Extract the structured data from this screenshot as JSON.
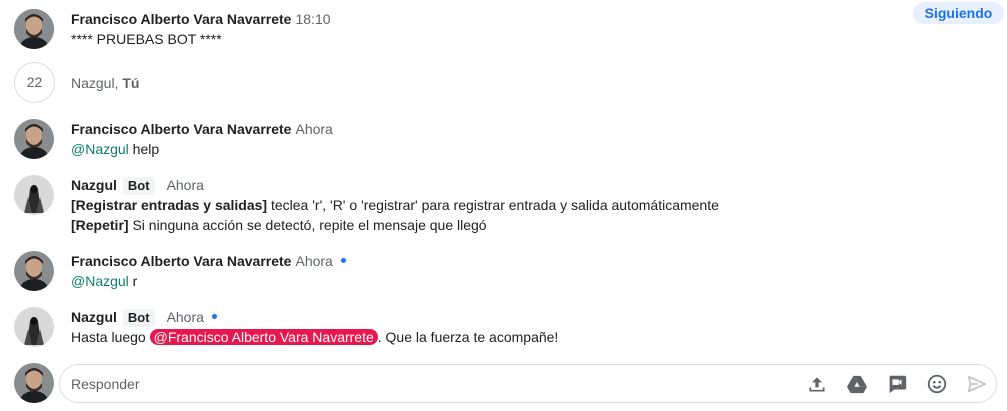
{
  "thread": {
    "follow_label": "Siguiendo",
    "original": {
      "author": "Francisco Alberto Vara Navarrete",
      "time": "18:10",
      "text": "**** PRUEBAS BOT ****"
    },
    "reply_summary": {
      "count": "22",
      "names": "Nazgul, ",
      "me": "Tú"
    }
  },
  "messages": [
    {
      "author": "Francisco Alberto Vara Navarrete",
      "time": "Ahora",
      "mention": "@Nazgul",
      "text": " help"
    },
    {
      "author": "Nazgul",
      "badge": "Bot",
      "time": "Ahora",
      "line1_bold": "[Registrar entradas y salidas]",
      "line1_text": " teclea 'r', 'R' o 'registrar' para registrar entrada y salida automáticamente",
      "line2_bold": "[Repetir]",
      "line2_text": " Si ninguna acción se detectó, repite el mensaje que llegó"
    },
    {
      "author": "Francisco Alberto Vara Navarrete",
      "time": "Ahora",
      "mention": "@Nazgul",
      "text": " r"
    },
    {
      "author": "Nazgul",
      "badge": "Bot",
      "time": "Ahora",
      "text_before": "Hasta luego ",
      "mention": "@Francisco Alberto Vara Navarrete",
      "text_after": ". Que la fuerza te acompañe!"
    }
  ],
  "reply": {
    "placeholder": "Responder",
    "icons": [
      "upload-icon",
      "drive-icon",
      "video-meet-icon",
      "emoji-icon",
      "send-icon"
    ]
  },
  "colors": {
    "accent": "#1a73e8",
    "follow_bg": "#e8f0fe",
    "mention": "#0b7e6b",
    "mention_me_bg": "#e8174f",
    "border": "#dadce0",
    "secondary_text": "#5f6368"
  }
}
